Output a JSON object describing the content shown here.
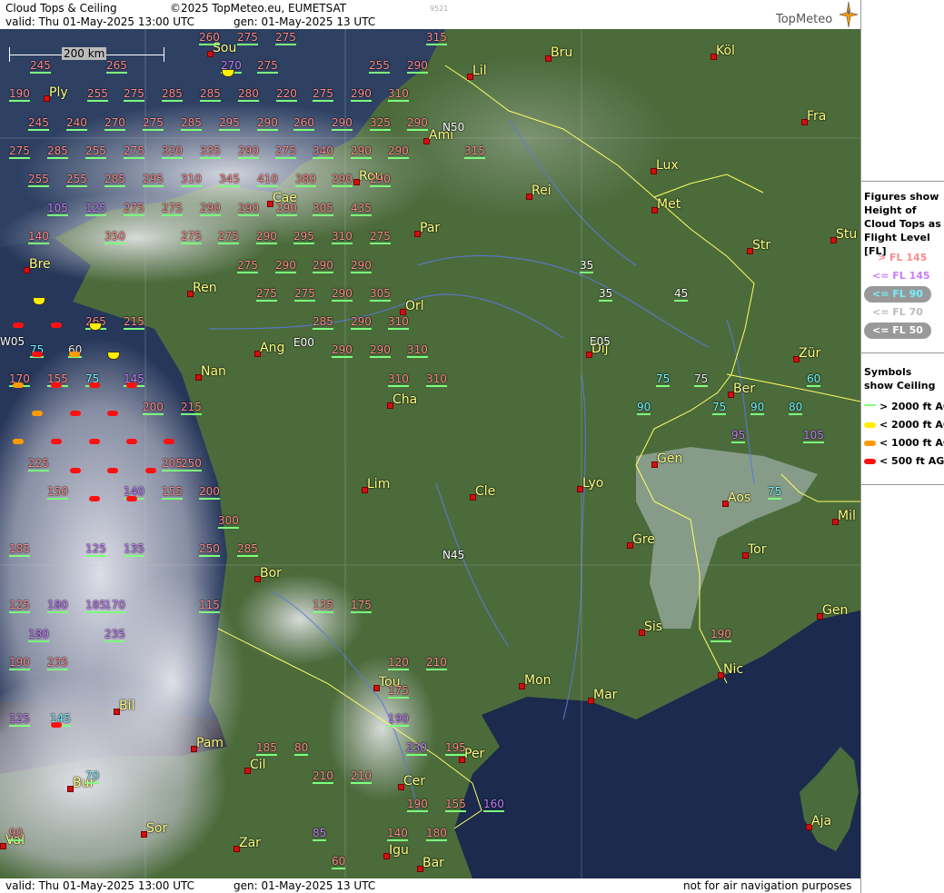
{
  "header": {
    "title": "Cloud Tops & Ceiling",
    "copyright": "©2025 TopMeteo.eu, EUMETSAT",
    "code": "9521",
    "valid": "valid:  Thu   01-May-2025   13:00 UTC",
    "gen": "gen: 01-May-2025 13 UTC",
    "logo": "TopMeteo"
  },
  "footer": {
    "valid": "valid:  Thu   01-May-2025   13:00 UTC",
    "gen": "gen: 01-May-2025 13 UTC",
    "disclaimer": "not for air navigation purposes"
  },
  "scale": "200 km",
  "colors": {
    "high": "#ff8a8a",
    "mid": "#c77dff",
    "low": "#6ff3ff",
    "lower": "#ffffff",
    "white2": "#e8e8e8",
    "sym_green": "#7dff7d",
    "sym_yellow": "#ffee00",
    "sym_orange": "#ff9a00",
    "sym_red": "#ff1010",
    "city": "#ffff80"
  },
  "legend": {
    "fig_title": "Figures show Height of Cloud Tops as Flight Level  [FL]",
    "fig": [
      {
        "text": "> FL 145",
        "color": "#ff8a8a"
      },
      {
        "text": "<= FL 145",
        "color": "#c77dff"
      },
      {
        "text": "<= FL 90",
        "color": "#6ff3ff"
      },
      {
        "text": "<= FL 70",
        "color": "#bbbbbb"
      },
      {
        "text": "<= FL 50",
        "color": "#ffffff"
      }
    ],
    "sym_title": "Symbols show Ceiling",
    "sym": [
      {
        "text": "> 2000 ft AGL",
        "color": "#7dff7d"
      },
      {
        "text": "< 2000 ft AGL",
        "color": "#ffee00"
      },
      {
        "text": "< 1000 ft AGL",
        "color": "#ff9a00"
      },
      {
        "text": "< 500 ft AGL",
        "color": "#ff1010"
      }
    ]
  },
  "cities": [
    "Sou",
    "Bru",
    "Köl",
    "Lil",
    "Ply",
    "Fra",
    "Ami",
    "Lux",
    "Rou",
    "Cae",
    "Rei",
    "Met",
    "Par",
    "Stu",
    "Str",
    "Bre",
    "Ren",
    "Orl",
    "Ang",
    "Nan",
    "Dij",
    "Zür",
    "Ber",
    "Cha",
    "Gen",
    "Lim",
    "Cle",
    "Lyo",
    "Aos",
    "Mil",
    "Gre",
    "Tor",
    "Bor",
    "Sis",
    "Gen",
    "Nic",
    "Mon",
    "Mar",
    "Tou",
    "Bil",
    "Pam",
    "Per",
    "Cil",
    "Bur",
    "Cer",
    "Sor",
    "Aja",
    "Val",
    "Zar",
    "Igu",
    "Bar"
  ],
  "grid_labels": [
    "N50",
    "E00",
    "W05",
    "E05",
    "N45"
  ],
  "figures": [
    "260",
    "275",
    "275",
    "315",
    "245",
    "265",
    "270",
    "275",
    "255",
    "290",
    "190",
    "255",
    "275",
    "285",
    "285",
    "280",
    "220",
    "275",
    "290",
    "310",
    "245",
    "240",
    "270",
    "275",
    "285",
    "295",
    "290",
    "260",
    "290",
    "325",
    "290",
    "275",
    "285",
    "255",
    "275",
    "320",
    "335",
    "290",
    "275",
    "340",
    "290",
    "290",
    "315",
    "255",
    "255",
    "285",
    "295",
    "310",
    "345",
    "410",
    "380",
    "290",
    "290",
    "105",
    "125",
    "275",
    "275",
    "290",
    "290",
    "290",
    "305",
    "435",
    "140",
    "350",
    "275",
    "275",
    "290",
    "295",
    "310",
    "275",
    "275",
    "290",
    "290",
    "290",
    "275",
    "275",
    "290",
    "305",
    "215",
    "265",
    "285",
    "290",
    "310",
    "60",
    "75",
    "290",
    "290",
    "310",
    "170",
    "155",
    "75",
    "145",
    "310",
    "310",
    "200",
    "215",
    "35",
    "35",
    "45",
    "75",
    "75",
    "60",
    "90",
    "75",
    "90",
    "80",
    "95",
    "105",
    "225",
    "205",
    "250",
    "200",
    "300",
    "75",
    "150",
    "140",
    "155",
    "185",
    "250",
    "285",
    "125",
    "135",
    "170",
    "125",
    "180",
    "185",
    "115",
    "135",
    "175",
    "180",
    "190",
    "235",
    "190",
    "120",
    "210",
    "235",
    "175",
    "125",
    "190",
    "230",
    "195",
    "185",
    "80",
    "210",
    "210",
    "145",
    "190",
    "155",
    "160",
    "140",
    "180",
    "90",
    "85",
    "60",
    "70"
  ]
}
